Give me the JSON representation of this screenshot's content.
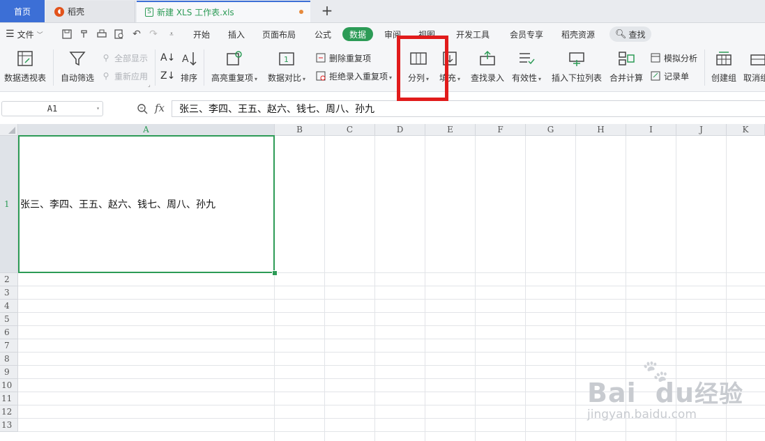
{
  "tabs": {
    "home": "首页",
    "docer": "稻壳",
    "file": "新建 XLS 工作表.xls"
  },
  "menu": {
    "file": "文件",
    "items": [
      "开始",
      "插入",
      "页面布局",
      "公式",
      "数据",
      "审阅",
      "视图",
      "开发工具",
      "会员专享",
      "稻壳资源"
    ],
    "active": "数据",
    "search": "查找"
  },
  "ribbon": {
    "pivot": "数据透视表",
    "autofilter": "自动筛选",
    "show_all": "全部显示",
    "reapply": "重新应用",
    "sort": "排序",
    "highlight_dup": "高亮重复项",
    "compare": "数据对比",
    "remove_dup": "删除重复项",
    "reject_dup": "拒绝录入重复项",
    "split": "分列",
    "fill": "填充",
    "lookup": "查找录入",
    "validity": "有效性",
    "insert_dropdown": "插入下拉列表",
    "consolidate": "合并计算",
    "whatif": "模拟分析",
    "record": "记录单",
    "group": "创建组",
    "ungroup": "取消组"
  },
  "formula_bar": {
    "name_box": "A1",
    "fx": "fx",
    "content": "张三、李四、王五、赵六、钱七、周八、孙九"
  },
  "grid": {
    "columns": [
      "A",
      "B",
      "C",
      "D",
      "E",
      "F",
      "G",
      "H",
      "I",
      "J",
      "K"
    ],
    "rows": [
      "1",
      "2",
      "3",
      "4",
      "5",
      "6",
      "7",
      "8",
      "9",
      "10",
      "11",
      "12",
      "13"
    ],
    "a1_value": "张三、李四、王五、赵六、钱七、周八、孙九"
  },
  "watermark": {
    "brand": "Bai",
    "brand2": "du",
    "cn": "经验",
    "url": "jingyan.baidu.com"
  },
  "colors": {
    "accent_green": "#2c9b56",
    "tab_blue": "#3c6fd6",
    "highlight_red": "#e11b1b"
  }
}
